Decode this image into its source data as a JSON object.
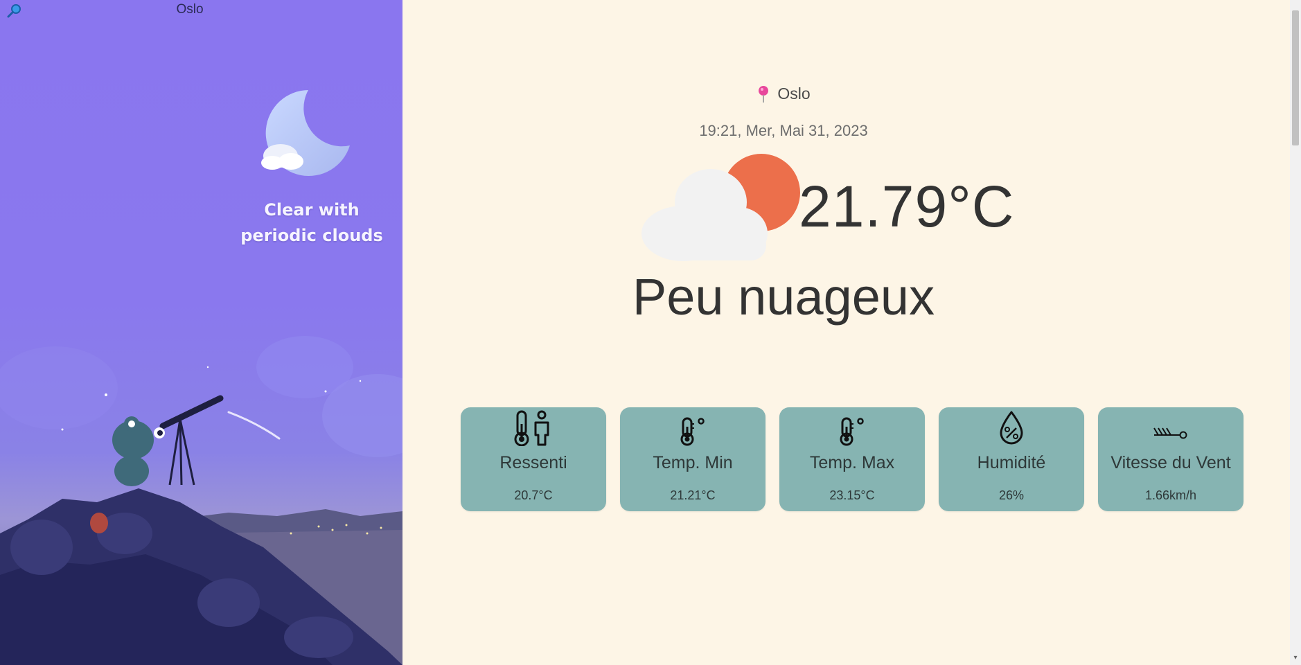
{
  "sidebar": {
    "city": "Oslo",
    "condition_line1": "Clear with",
    "condition_line2": "periodic clouds",
    "search_icon": "search-icon"
  },
  "main": {
    "location": "Oslo",
    "datetime": "19:21, Mer, Mai 31, 2023",
    "temperature": "21.79°C",
    "description": "Peu nuageux",
    "weather_icon": "partly-cloudy-icon"
  },
  "cards": [
    {
      "title": "Ressenti",
      "value": "20.7°C",
      "icon": "feels-like-icon"
    },
    {
      "title": "Temp. Min",
      "value": "21.21°C",
      "icon": "thermometer-icon"
    },
    {
      "title": "Temp. Max",
      "value": "23.15°C",
      "icon": "thermometer-icon"
    },
    {
      "title": "Humidité",
      "value": "26%",
      "icon": "humidity-icon"
    },
    {
      "title": "Vitesse du Vent",
      "value": "1.66km/h",
      "icon": "wind-icon"
    }
  ],
  "colors": {
    "background": "#fdf5e6",
    "card": "#86b4b2",
    "sidebar": "#8a76ef",
    "sun": "#ec6f4b"
  }
}
